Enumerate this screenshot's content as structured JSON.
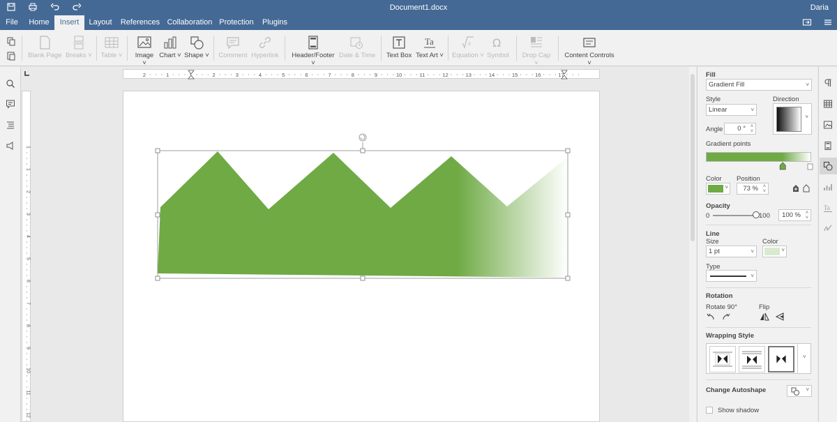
{
  "titlebar": {
    "doc_title": "Document1.docx",
    "user": "Daria"
  },
  "menu": {
    "tabs": [
      "File",
      "Home",
      "Insert",
      "Layout",
      "References",
      "Collaboration",
      "Protection",
      "Plugins"
    ],
    "active": "Insert"
  },
  "toolbar": {
    "blank_page": "Blank Page",
    "breaks": "Breaks",
    "table": "Table",
    "image": "Image",
    "chart": "Chart",
    "shape": "Shape",
    "comment": "Comment",
    "hyperlink": "Hyperlink",
    "header_footer": "Header/Footer",
    "date_time": "Date & Time",
    "text_box": "Text Box",
    "text_art": "Text Art",
    "equation": "Equation",
    "symbol": "Symbol",
    "drop_cap": "Drop Cap",
    "content_controls": "Content Controls"
  },
  "ruler": {
    "h_numbers": [
      "2",
      "1",
      "1",
      "2",
      "3",
      "4",
      "5",
      "6",
      "7",
      "8",
      "9",
      "10",
      "11",
      "12",
      "13",
      "14",
      "15",
      "16",
      "17"
    ],
    "v_numbers": [
      "1",
      "1",
      "2",
      "3",
      "4",
      "5",
      "6",
      "7",
      "8",
      "9",
      "10",
      "11",
      "12"
    ]
  },
  "shape": {
    "gradient_start": "#6faa45",
    "gradient_end": "#ffffff",
    "gradient_position_pct": 73
  },
  "panel": {
    "fill_label": "Fill",
    "fill_value": "Gradient Fill",
    "style_label": "Style",
    "style_value": "Linear",
    "direction_label": "Direction",
    "angle_label": "Angle",
    "angle_value": "0 °",
    "gradient_points_label": "Gradient points",
    "color_label": "Color",
    "position_label": "Position",
    "position_value": "73 %",
    "opacity_label": "Opacity",
    "opacity_min": "0",
    "opacity_max": "100",
    "opacity_value": "100 %",
    "opacity_level": 100,
    "line_label": "Line",
    "size_label": "Size",
    "size_value": "1 pt",
    "line_color_label": "Color",
    "type_label": "Type",
    "rotation_label": "Rotation",
    "rotate_label": "Rotate 90°",
    "flip_label": "Flip",
    "wrapping_label": "Wrapping Style",
    "change_autoshape_label": "Change Autoshape",
    "show_shadow_label": "Show shadow",
    "fill_color": "#6faa45",
    "line_color": "#d9ead0"
  }
}
